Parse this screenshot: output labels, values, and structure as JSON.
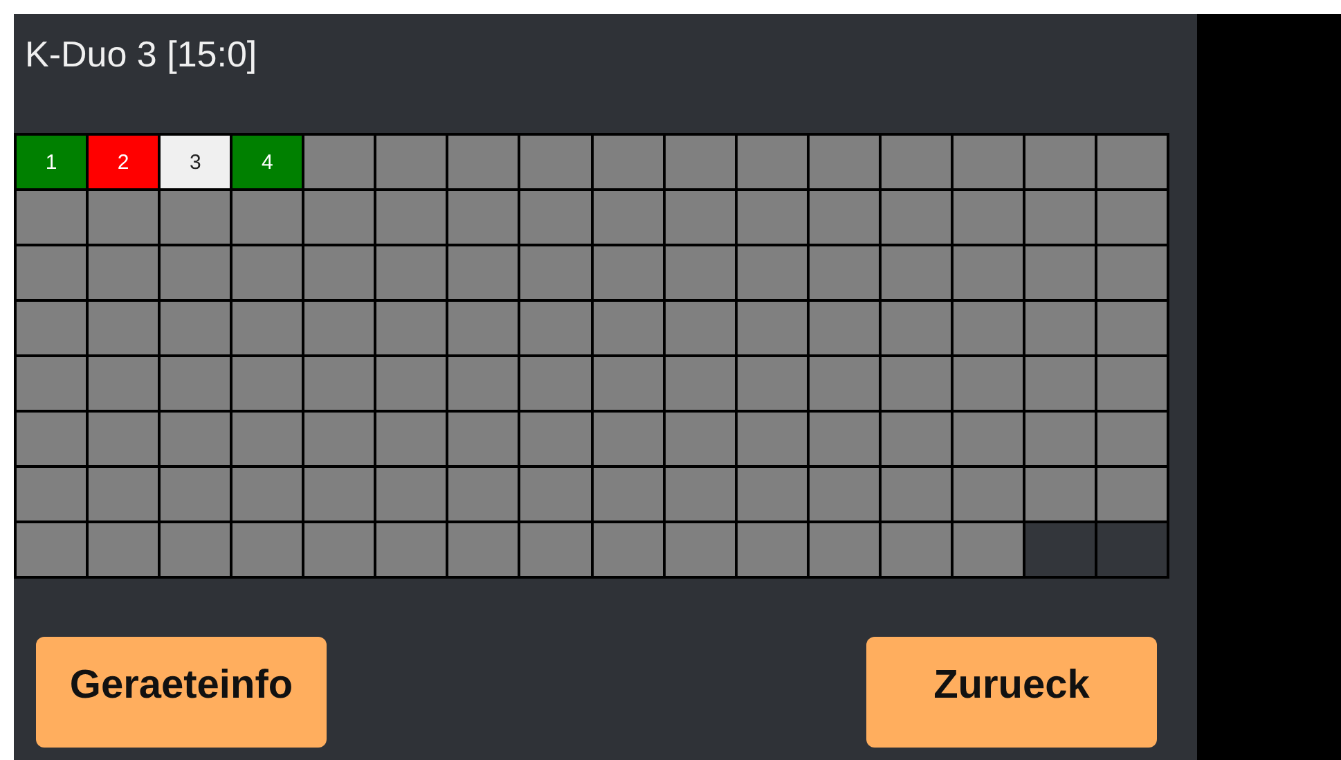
{
  "title": "K-Duo 3 [15:0]",
  "grid": {
    "rows": [
      [
        {
          "label": "1",
          "color": "#008000"
        },
        {
          "label": "2",
          "color": "#ff0000"
        },
        {
          "label": "3",
          "color": "#f0f0f0"
        },
        {
          "label": "4",
          "color": "#008000"
        },
        {
          "color": "#808080"
        },
        {
          "color": "#808080"
        },
        {
          "color": "#808080"
        },
        {
          "color": "#808080"
        },
        {
          "color": "#808080"
        },
        {
          "color": "#808080"
        },
        {
          "color": "#808080"
        },
        {
          "color": "#808080"
        },
        {
          "color": "#808080"
        },
        {
          "color": "#808080"
        },
        {
          "color": "#808080"
        },
        {
          "color": "#808080"
        }
      ],
      [
        {
          "color": "#808080"
        },
        {
          "color": "#808080"
        },
        {
          "color": "#808080"
        },
        {
          "color": "#808080"
        },
        {
          "color": "#808080"
        },
        {
          "color": "#808080"
        },
        {
          "color": "#808080"
        },
        {
          "color": "#808080"
        },
        {
          "color": "#808080"
        },
        {
          "color": "#808080"
        },
        {
          "color": "#808080"
        },
        {
          "color": "#808080"
        },
        {
          "color": "#808080"
        },
        {
          "color": "#808080"
        },
        {
          "color": "#808080"
        },
        {
          "color": "#808080"
        }
      ],
      [
        {
          "color": "#808080"
        },
        {
          "color": "#808080"
        },
        {
          "color": "#808080"
        },
        {
          "color": "#808080"
        },
        {
          "color": "#808080"
        },
        {
          "color": "#808080"
        },
        {
          "color": "#808080"
        },
        {
          "color": "#808080"
        },
        {
          "color": "#808080"
        },
        {
          "color": "#808080"
        },
        {
          "color": "#808080"
        },
        {
          "color": "#808080"
        },
        {
          "color": "#808080"
        },
        {
          "color": "#808080"
        },
        {
          "color": "#808080"
        },
        {
          "color": "#808080"
        }
      ],
      [
        {
          "color": "#808080"
        },
        {
          "color": "#808080"
        },
        {
          "color": "#808080"
        },
        {
          "color": "#808080"
        },
        {
          "color": "#808080"
        },
        {
          "color": "#808080"
        },
        {
          "color": "#808080"
        },
        {
          "color": "#808080"
        },
        {
          "color": "#808080"
        },
        {
          "color": "#808080"
        },
        {
          "color": "#808080"
        },
        {
          "color": "#808080"
        },
        {
          "color": "#808080"
        },
        {
          "color": "#808080"
        },
        {
          "color": "#808080"
        },
        {
          "color": "#808080"
        }
      ],
      [
        {
          "color": "#808080"
        },
        {
          "color": "#808080"
        },
        {
          "color": "#808080"
        },
        {
          "color": "#808080"
        },
        {
          "color": "#808080"
        },
        {
          "color": "#808080"
        },
        {
          "color": "#808080"
        },
        {
          "color": "#808080"
        },
        {
          "color": "#808080"
        },
        {
          "color": "#808080"
        },
        {
          "color": "#808080"
        },
        {
          "color": "#808080"
        },
        {
          "color": "#808080"
        },
        {
          "color": "#808080"
        },
        {
          "color": "#808080"
        },
        {
          "color": "#808080"
        }
      ],
      [
        {
          "color": "#808080"
        },
        {
          "color": "#808080"
        },
        {
          "color": "#808080"
        },
        {
          "color": "#808080"
        },
        {
          "color": "#808080"
        },
        {
          "color": "#808080"
        },
        {
          "color": "#808080"
        },
        {
          "color": "#808080"
        },
        {
          "color": "#808080"
        },
        {
          "color": "#808080"
        },
        {
          "color": "#808080"
        },
        {
          "color": "#808080"
        },
        {
          "color": "#808080"
        },
        {
          "color": "#808080"
        },
        {
          "color": "#808080"
        },
        {
          "color": "#808080"
        }
      ],
      [
        {
          "color": "#808080"
        },
        {
          "color": "#808080"
        },
        {
          "color": "#808080"
        },
        {
          "color": "#808080"
        },
        {
          "color": "#808080"
        },
        {
          "color": "#808080"
        },
        {
          "color": "#808080"
        },
        {
          "color": "#808080"
        },
        {
          "color": "#808080"
        },
        {
          "color": "#808080"
        },
        {
          "color": "#808080"
        },
        {
          "color": "#808080"
        },
        {
          "color": "#808080"
        },
        {
          "color": "#808080"
        },
        {
          "color": "#808080"
        },
        {
          "color": "#808080"
        }
      ],
      [
        {
          "color": "#808080"
        },
        {
          "color": "#808080"
        },
        {
          "color": "#808080"
        },
        {
          "color": "#808080"
        },
        {
          "color": "#808080"
        },
        {
          "color": "#808080"
        },
        {
          "color": "#808080"
        },
        {
          "color": "#808080"
        },
        {
          "color": "#808080"
        },
        {
          "color": "#808080"
        },
        {
          "color": "#808080"
        },
        {
          "color": "#808080"
        },
        {
          "color": "#808080"
        },
        {
          "color": "#808080"
        },
        {
          "color": "#33363b"
        },
        {
          "color": "#33363b"
        }
      ]
    ]
  },
  "buttons": [
    {
      "label": "Geraeteinfo"
    },
    {
      "label": "Zurueck"
    }
  ]
}
